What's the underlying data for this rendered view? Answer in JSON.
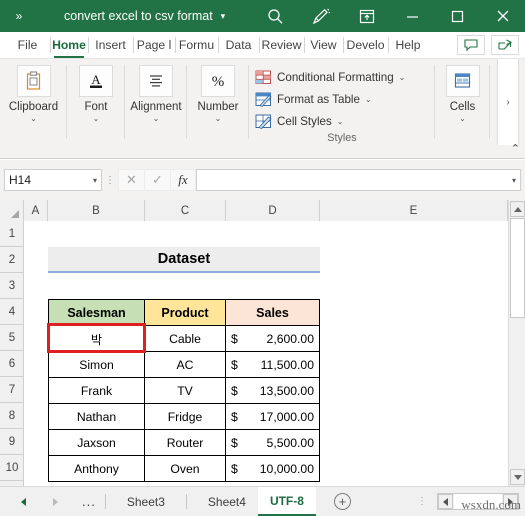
{
  "titlebar": {
    "chevron": "»",
    "document_title": "convert excel to csv format",
    "caret": "▾",
    "icons": [
      {
        "name": "search-icon",
        "label": "Search"
      },
      {
        "name": "ink-pen-icon",
        "label": "Draw"
      },
      {
        "name": "ribbon-display-options-icon",
        "label": "Ribbon Display Options"
      },
      {
        "name": "minimize-icon",
        "label": "Minimize"
      },
      {
        "name": "maximize-icon",
        "label": "Maximize"
      },
      {
        "name": "close-icon",
        "label": "Close"
      }
    ]
  },
  "ribbon_tabs": [
    {
      "label": "File",
      "active": false
    },
    {
      "label": "Home",
      "active": true
    },
    {
      "label": "Insert",
      "active": false
    },
    {
      "label": "Page l",
      "active": false
    },
    {
      "label": "Formu",
      "active": false
    },
    {
      "label": "Data",
      "active": false
    },
    {
      "label": "Review",
      "active": false
    },
    {
      "label": "View",
      "active": false
    },
    {
      "label": "Develo",
      "active": false
    },
    {
      "label": "Help",
      "active": false
    }
  ],
  "ribbon_right_buttons": [
    {
      "name": "comments-button",
      "icon": "comment-icon"
    },
    {
      "name": "share-button",
      "icon": "share-icon"
    }
  ],
  "ribbon": {
    "groups": [
      {
        "label": "Clipboard",
        "icon": "clipboard-icon",
        "caret": "⌄"
      },
      {
        "label": "Font",
        "icon": "font-A-icon",
        "caret": "⌄"
      },
      {
        "label": "Alignment",
        "icon": "alignment-icon",
        "caret": "⌄"
      },
      {
        "label": "Number",
        "icon": "percent-icon",
        "caret": "⌄"
      },
      {
        "label": "Cells",
        "icon": "cells-icon",
        "caret": "⌄"
      }
    ],
    "styles": {
      "group_title": "Styles",
      "items": [
        {
          "label": "Conditional Formatting",
          "caret": "⌄",
          "icon": "conditional-formatting-icon"
        },
        {
          "label": "Format as Table",
          "caret": "⌄",
          "icon": "format-as-table-icon"
        },
        {
          "label": "Cell Styles",
          "caret": "⌄",
          "icon": "cell-styles-icon"
        }
      ]
    },
    "overflow_chevron": "›",
    "collapse_chevron": "⌃"
  },
  "formula_bar": {
    "name_box_value": "H14",
    "name_box_caret": "▾",
    "cancel_icon": "✕",
    "enter_icon": "✓",
    "fx_icon": "fx",
    "formula_value": "",
    "expand_caret": "▾"
  },
  "grid": {
    "columns": [
      "A",
      "B",
      "C",
      "D",
      "E"
    ],
    "rows": [
      "1",
      "2",
      "3",
      "4",
      "5",
      "6",
      "7",
      "8",
      "9",
      "10"
    ],
    "title_cell": {
      "text": "Dataset",
      "fill": "#ededed",
      "underline": "#8faadc"
    },
    "headers": [
      {
        "text": "Salesman",
        "fill": "#c6dfb4"
      },
      {
        "text": "Product",
        "fill": "#fee599"
      },
      {
        "text": "Sales",
        "fill": "#fce4d6"
      }
    ],
    "table_rows": [
      {
        "salesman": "박",
        "product": "Cable",
        "currency": "$",
        "amount": "2,600.00"
      },
      {
        "salesman": "Simon",
        "product": "AC",
        "currency": "$",
        "amount": "11,500.00"
      },
      {
        "salesman": "Frank",
        "product": "TV",
        "currency": "$",
        "amount": "13,500.00"
      },
      {
        "salesman": "Nathan",
        "product": "Fridge",
        "currency": "$",
        "amount": "17,000.00"
      },
      {
        "salesman": "Jaxson",
        "product": "Router",
        "currency": "$",
        "amount": "5,500.00"
      },
      {
        "salesman": "Anthony",
        "product": "Oven",
        "currency": "$",
        "amount": "10,000.00"
      }
    ],
    "selection": {
      "cell": "B5",
      "border_color": "#e02020"
    }
  },
  "tabbar": {
    "prev_arrow": "◀",
    "next_arrow": "▶",
    "ellipsis": "...",
    "sheets": [
      {
        "label": "Sheet3",
        "active": false
      },
      {
        "label": "Sheet4",
        "active": false
      },
      {
        "label": "UTF-8",
        "active": true
      }
    ],
    "add_sheet": "+",
    "dots": "⋮"
  },
  "watermark": "wsxdn.com"
}
